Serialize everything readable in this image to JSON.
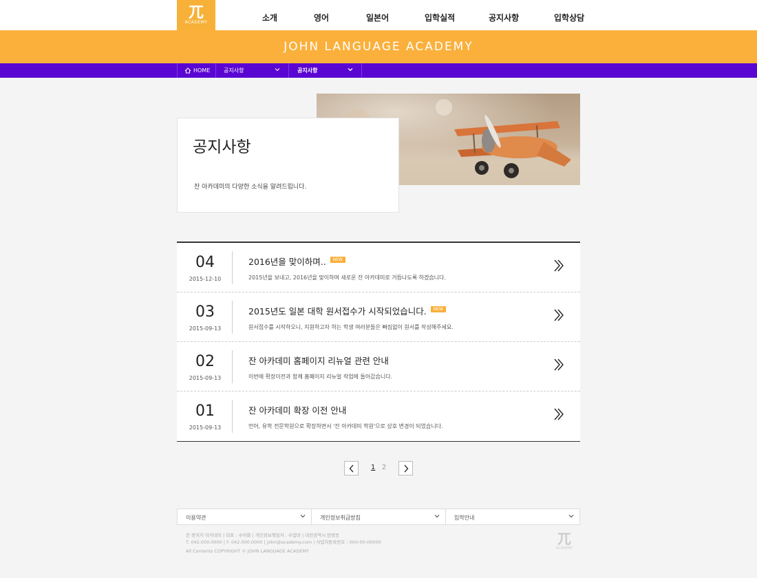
{
  "header": {
    "logo_mark": "兀",
    "logo_text": "ACADEMY",
    "nav": [
      "소개",
      "영어",
      "일본어",
      "입학실적",
      "공지사항",
      "입학상담"
    ]
  },
  "banner": {
    "title": "JOHN LANGUAGE ACADEMY"
  },
  "breadcrumb": {
    "home": "HOME",
    "level1": "공지사항",
    "level2": "공지사항"
  },
  "hero": {
    "title": "공지사항",
    "description": "잔 아카데미의 다양한 소식을 알려드립니다."
  },
  "notices": [
    {
      "num": "04",
      "date": "2015-12-10",
      "title": "2016년을 맞이하며..",
      "badge": "NEW",
      "summary": "2015년을 보내고, 2016년을 맞이하며 새로운 잔 아카데미로 거듭나도록 하겠습니다."
    },
    {
      "num": "03",
      "date": "2015-09-13",
      "title": "2015년도 일본 대학 원서접수가 시작되었습니다.",
      "badge": "NEW",
      "summary": "원서접수를 시작하오니, 지원하고자 하는 학생 여러분들은 빠짐없이 원서를 작성해주세요."
    },
    {
      "num": "02",
      "date": "2015-09-13",
      "title": "잔 아카데미 홈페이지 리뉴얼 관련 안내",
      "badge": "",
      "summary": "이번에 확장이전과 함께 홈페이지 리뉴얼 작업에 들어갔습니다."
    },
    {
      "num": "01",
      "date": "2015-09-13",
      "title": "잔 아카데미 확장 이전 안내",
      "badge": "",
      "summary": "언어, 유학 전문학원으로 확장하면서 '잔 아카데미 학원'으로 상호 변경이 되었습니다."
    }
  ],
  "pagination": {
    "pages": [
      "1",
      "2"
    ],
    "current": "1"
  },
  "footer": {
    "selects": [
      "이용약관",
      "개인정보취급방침",
      "입학안내"
    ],
    "info_line1": "잔 랭귀지 아카데미  |  대표 : 수아화  |  개인정보책임자 : 수업마  |  대전광역시 탄방동",
    "info_line2": "T. 042.000.0000  |  F. 042.000.0000  |  john@academy.com  |  사업자등록번호 : 000-00-00000",
    "copyright": "All Contents COPYRIGHT © JOHN LANGUAGE ACADEMY",
    "logo_mark": "兀",
    "logo_text": "ACADEMY"
  },
  "colors": {
    "accent_orange": "#fbb03b",
    "accent_purple": "#5a06d3"
  }
}
